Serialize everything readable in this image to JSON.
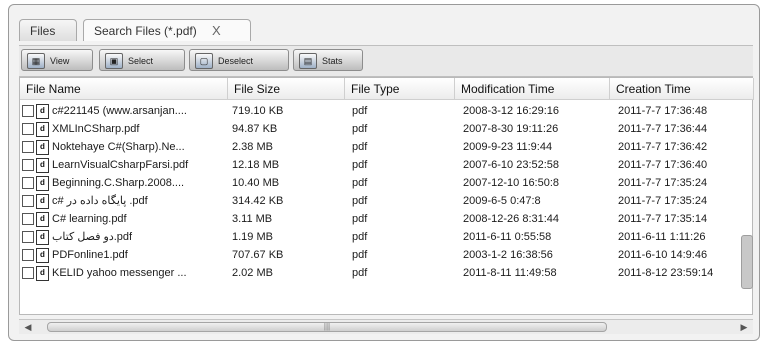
{
  "tabs": [
    {
      "label": "Files"
    },
    {
      "label": "Search Files (*.pdf)",
      "close": "X"
    }
  ],
  "toolbar": {
    "view_label": "View",
    "select_label": "Select",
    "deselect_label": "Deselect",
    "stats_label": "Stats"
  },
  "table": {
    "headers": [
      "File Name",
      "File Size",
      "File Type",
      "Modification Time",
      "Creation Time"
    ],
    "rows": [
      {
        "name": "c#221145 (www.arsanjan....",
        "size": "719.10 KB",
        "type": "pdf",
        "modified": "2008-3-12 16:29:16",
        "created": "2011-7-7 17:36:48"
      },
      {
        "name": "XMLInCSharp.pdf",
        "size": "94.87 KB",
        "type": "pdf",
        "modified": "2007-8-30 19:11:26",
        "created": "2011-7-7 17:36:44"
      },
      {
        "name": "Noktehaye C#(Sharp).Ne...",
        "size": "2.38 MB",
        "type": "pdf",
        "modified": "2009-9-23 11:9:44",
        "created": "2011-7-7 17:36:42"
      },
      {
        "name": "LearnVisualCsharpFarsi.pdf",
        "size": "12.18 MB",
        "type": "pdf",
        "modified": "2007-6-10 23:52:58",
        "created": "2011-7-7 17:36:40"
      },
      {
        "name": "Beginning.C.Sharp.2008....",
        "size": "10.40 MB",
        "type": "pdf",
        "modified": "2007-12-10 16:50:8",
        "created": "2011-7-7 17:35:24"
      },
      {
        "name": "c# پایگاه داده در .pdf",
        "size": "314.42 KB",
        "type": "pdf",
        "modified": "2009-6-5 0:47:8",
        "created": "2011-7-7 17:35:24"
      },
      {
        "name": "C# learning.pdf",
        "size": "3.11 MB",
        "type": "pdf",
        "modified": "2008-12-26 8:31:44",
        "created": "2011-7-7 17:35:14"
      },
      {
        "name": "دو فصل کتاب.pdf",
        "size": "1.19 MB",
        "type": "pdf",
        "modified": "2011-6-11 0:55:58",
        "created": "2011-6-11 1:11:26"
      },
      {
        "name": "PDFonline1.pdf",
        "size": "707.67 KB",
        "type": "pdf",
        "modified": "2003-1-2 16:38:56",
        "created": "2011-6-10 14:9:46"
      },
      {
        "name": "KELID yahoo messenger ...",
        "size": "2.02 MB",
        "type": "pdf",
        "modified": "2011-8-11 11:49:58",
        "created": "2011-8-12 23:59:14"
      }
    ]
  },
  "icons": {
    "file": "pdf-file-icon",
    "view": "grid-view-icon",
    "select": "select-icon",
    "deselect": "deselect-icon",
    "stats": "stats-icon"
  }
}
